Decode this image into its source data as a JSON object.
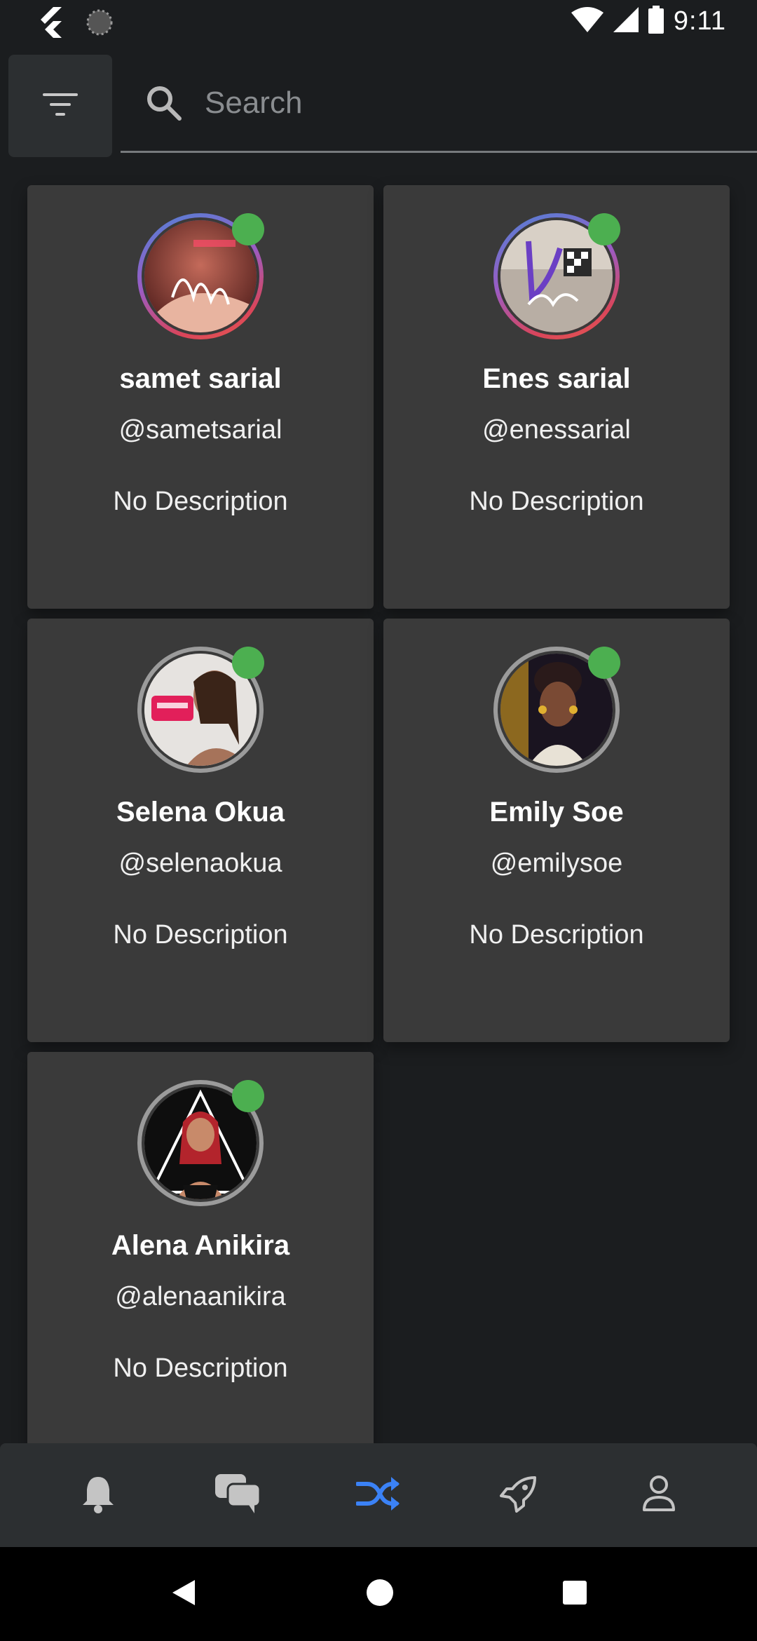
{
  "status_bar": {
    "time": "9:11",
    "icons": [
      "flutter-logo-icon",
      "loading-spinner-icon",
      "wifi-icon",
      "cell-signal-icon",
      "battery-icon"
    ]
  },
  "search": {
    "placeholder": "Search",
    "value": ""
  },
  "colors": {
    "background": "#1b1d1f",
    "card": "#3a3a3a",
    "online": "#4caf50",
    "active_nav": "#3b82f6",
    "inactive_nav": "#c4c4c4"
  },
  "users": [
    {
      "name": "samet sarial",
      "handle": "@sametsarial",
      "description": "No Description",
      "online": true,
      "ring": "gradient"
    },
    {
      "name": "Enes sarial",
      "handle": "@enessarial",
      "description": "No Description",
      "online": true,
      "ring": "gradient"
    },
    {
      "name": "Selena Okua",
      "handle": "@selenaokua",
      "description": "No Description",
      "online": true,
      "ring": "plain"
    },
    {
      "name": "Emily Soe",
      "handle": "@emilysoe",
      "description": "No Description",
      "online": true,
      "ring": "plain"
    },
    {
      "name": "Alena Anikira",
      "handle": "@alenaanikira",
      "description": "No Description",
      "online": true,
      "ring": "plain"
    }
  ],
  "bottom_nav": {
    "items": [
      "bell-icon",
      "chat-bubbles-icon",
      "shuffle-icon",
      "rocket-icon",
      "person-icon"
    ],
    "active": "shuffle-icon"
  },
  "system_nav": [
    "back-icon",
    "home-icon",
    "recents-icon"
  ]
}
